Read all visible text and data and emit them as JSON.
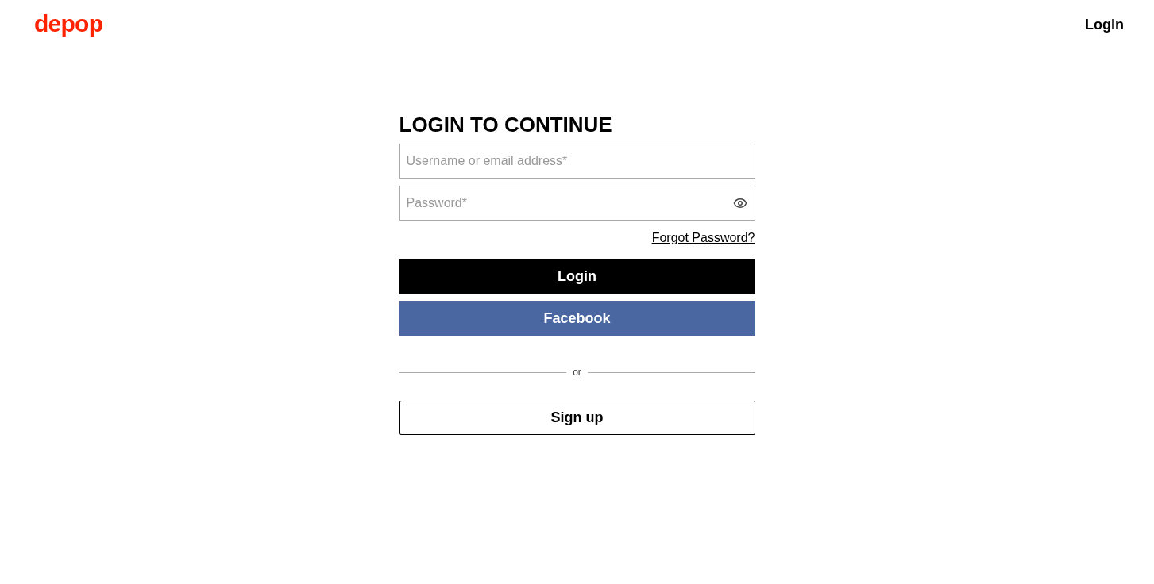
{
  "header": {
    "logo": "depop",
    "login_link": "Login"
  },
  "form": {
    "title": "LOGIN TO CONTINUE",
    "fields": [
      {
        "placeholder": "Username or email address*",
        "kind": "text"
      },
      {
        "placeholder": "Password*",
        "kind": "password"
      }
    ],
    "forgot_link": "Forgot Password?",
    "buttons": [
      {
        "label": "Login",
        "kind": "primary"
      },
      {
        "label": "Facebook",
        "kind": "facebook"
      }
    ],
    "divider": "or",
    "signup_button": "Sign up"
  }
}
